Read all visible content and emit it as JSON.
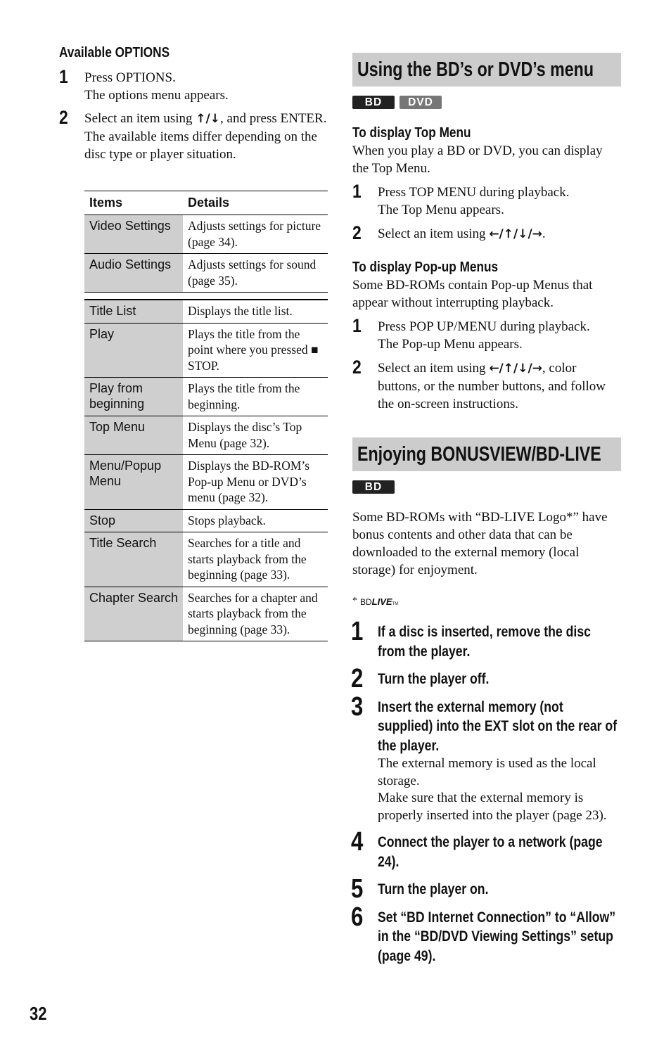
{
  "left": {
    "heading": "Available OPTIONS",
    "steps": [
      {
        "num": "1",
        "lines": [
          "Press OPTIONS.",
          "The options menu appears."
        ]
      },
      {
        "num": "2",
        "pre": "Select an item using ",
        "arrows": "↑/↓",
        "post": ", and press ENTER.",
        "note": "The available items differ depending on the disc type or player situation."
      }
    ],
    "table": {
      "headers": [
        "Items",
        "Details"
      ],
      "group1": [
        {
          "item": "Video Settings",
          "details": "Adjusts settings for picture (page 34)."
        },
        {
          "item": "Audio Settings",
          "details": "Adjusts settings for sound (page 35)."
        }
      ],
      "group2": [
        {
          "item": "Title List",
          "details": "Displays the title list."
        },
        {
          "item": "Play",
          "details": "Plays the title from the point where you pressed ■ STOP."
        },
        {
          "item": "Play from beginning",
          "details": "Plays the title from the beginning."
        },
        {
          "item": "Top Menu",
          "details": "Displays the disc’s Top Menu (page 32)."
        },
        {
          "item": "Menu/Popup Menu",
          "details": "Displays the BD-ROM’s Pop-up Menu or DVD’s menu (page 32)."
        },
        {
          "item": "Stop",
          "details": "Stops playback."
        },
        {
          "item": "Title Search",
          "details": "Searches for a title and starts playback from the beginning (page 33)."
        },
        {
          "item": "Chapter Search",
          "details": "Searches for a chapter and starts playback from the beginning (page 33)."
        }
      ]
    }
  },
  "right": {
    "section1": {
      "title": "Using the BD’s or DVD’s menu",
      "badges": [
        "BD",
        "DVD"
      ],
      "top_menu": {
        "heading": "To display Top Menu",
        "intro": "When you play a BD or DVD, you can display the Top Menu.",
        "step1_line1": "Press TOP MENU during playback.",
        "step1_line2": "The Top Menu appears.",
        "step2_pre": "Select an item using ",
        "step2_arrows": "←/↑/↓/→",
        "step2_post": "."
      },
      "popup_menu": {
        "heading": "To display Pop-up Menus",
        "intro": "Some BD-ROMs contain Pop-up Menus that appear without interrupting playback.",
        "step1_line1": "Press POP UP/MENU during playback.",
        "step1_line2": "The Pop-up Menu appears.",
        "step2_pre": "Select an item using ",
        "step2_arrows": "←/↑/↓/→",
        "step2_post": ", color buttons, or the number buttons, and follow the on-screen instructions."
      }
    },
    "section2": {
      "title": "Enjoying BONUSVIEW/BD-LIVE",
      "badge": "BD",
      "intro": "Some BD-ROMs with “BD-LIVE Logo*” have bonus contents and other data that can be downloaded to the external memory (local storage) for enjoyment.",
      "logo": {
        "asterisk": "*",
        "bd": "BD",
        "live": "LIVE",
        "tm": "TM"
      },
      "steps": [
        {
          "num": "1",
          "text": "If a disc is inserted, remove the disc from the player."
        },
        {
          "num": "2",
          "text": "Turn the player off."
        },
        {
          "num": "3",
          "text": "Insert the external memory (not supplied) into the EXT slot on the rear of the player.",
          "note1": "The external memory is used as the local storage.",
          "note2": "Make sure that the external memory is properly inserted into the player (page 23)."
        },
        {
          "num": "4",
          "text": "Connect the player to a network (page 24)."
        },
        {
          "num": "5",
          "text": "Turn the player on."
        },
        {
          "num": "6",
          "text": "Set “BD Internet Connection” to “Allow” in the “BD/DVD Viewing Settings” setup (page 49)."
        }
      ]
    }
  },
  "page_number": "32"
}
